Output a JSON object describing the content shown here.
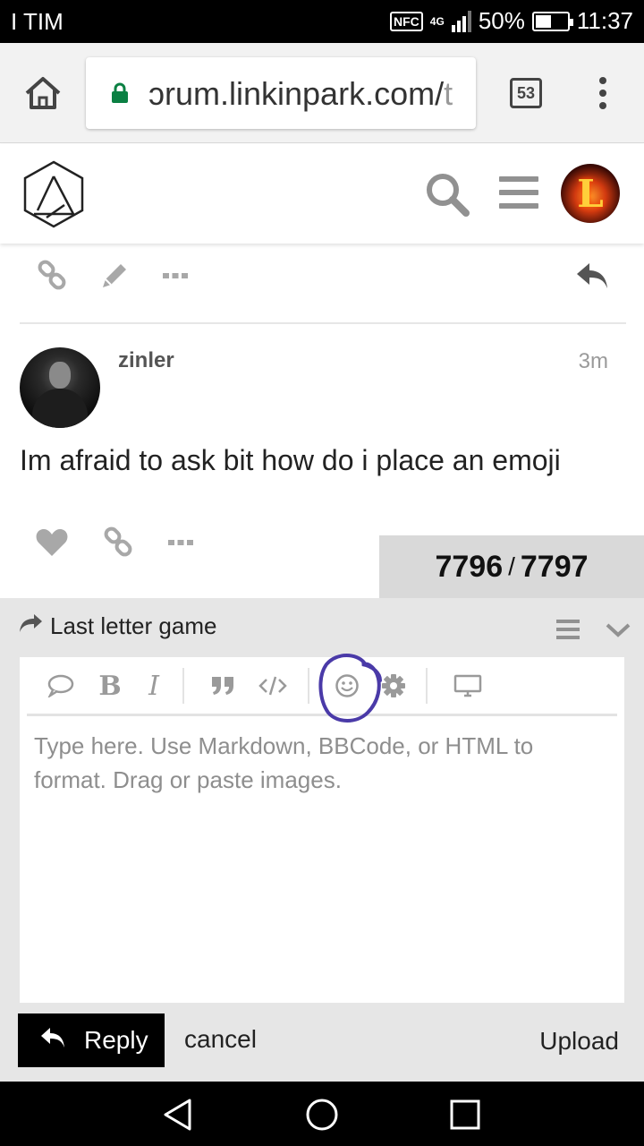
{
  "status_bar": {
    "carrier": "I TIM",
    "nfc": "NFC",
    "network": "4G",
    "battery": "50%",
    "battery_level": 0.5,
    "time": "11:37"
  },
  "browser": {
    "url_main": "ɔrum.linkinpark.com/",
    "url_dim": "t",
    "tab_count": "53"
  },
  "post": {
    "username": "zinler",
    "time": "3m",
    "body": "Im afraid to ask bit how do i place an emoji"
  },
  "progress": {
    "current": "7796",
    "separator": "/",
    "total": "7797"
  },
  "composer": {
    "topic_title": "Last letter game",
    "placeholder": "Type here. Use Markdown, BBCode, or HTML to format. Drag or paste images.",
    "reply_label": "Reply",
    "cancel_label": "cancel",
    "upload_label": "Upload",
    "toolbar": {
      "bold": "B",
      "italic": "I"
    }
  },
  "colors": {
    "annotation": "#4a3aa8",
    "icon_gray": "#9a9a9a"
  }
}
